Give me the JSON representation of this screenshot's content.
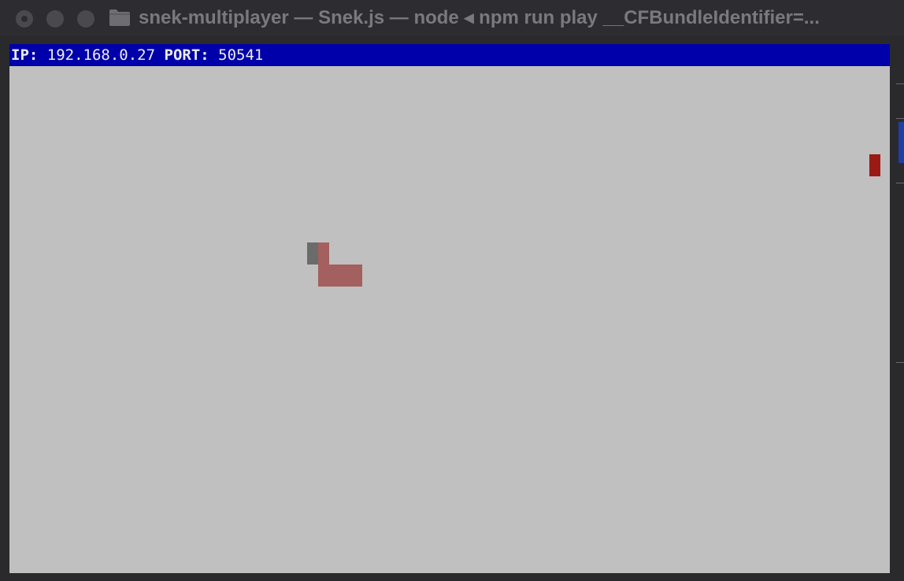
{
  "window": {
    "title": "snek-multiplayer — Snek.js — node ◂ npm run play __CFBundleIdentifier=..."
  },
  "status": {
    "ip_label": "IP:",
    "ip_value": "192.168.0.27",
    "port_label": "PORT:",
    "port_value": "50541"
  },
  "colors": {
    "terminal_background": "#c0c0c0",
    "status_bar": "#0000aa",
    "snake_body": "#a45f5f",
    "snake_head": "#6b6b6b",
    "food": "#9b1a14"
  },
  "game": {
    "snake": {
      "head_color_name": "gray",
      "body_color_name": "red"
    },
    "food": {
      "color_name": "dark-red"
    }
  }
}
